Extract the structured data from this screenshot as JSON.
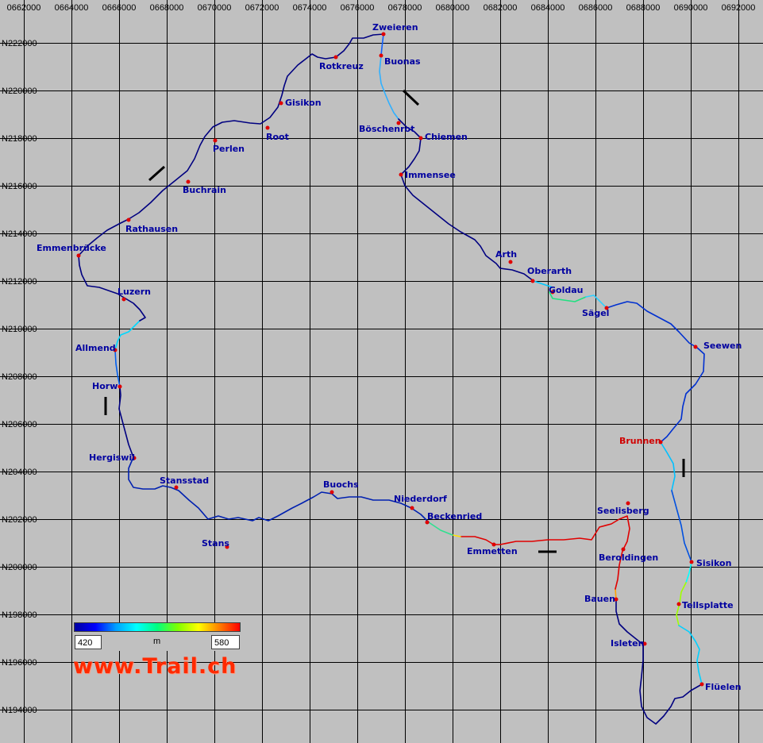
{
  "map": {
    "x_axis_labels": [
      "0662000",
      "0664000",
      "0666000",
      "0668000",
      "0670000",
      "0672000",
      "0674000",
      "0676000",
      "0678000",
      "0680000",
      "0682000",
      "0684000",
      "0686000",
      "0688000",
      "0690000",
      "0692000"
    ],
    "y_axis_labels": [
      "N222000",
      "N220000",
      "N218000",
      "N216000",
      "N214000",
      "N212000",
      "N210000",
      "N208000",
      "N206000",
      "N204000",
      "N202000",
      "N200000",
      "N198000",
      "N196000",
      "N194000"
    ],
    "places": [
      {
        "name": "Zweieren",
        "color": "blue"
      },
      {
        "name": "Rotkreuz",
        "color": "blue"
      },
      {
        "name": "Buonas",
        "color": "blue"
      },
      {
        "name": "Gisikon",
        "color": "blue"
      },
      {
        "name": "Böschenrot",
        "color": "blue"
      },
      {
        "name": "Root",
        "color": "blue"
      },
      {
        "name": "Chiemen",
        "color": "blue"
      },
      {
        "name": "Perlen",
        "color": "blue"
      },
      {
        "name": "Immensee",
        "color": "blue"
      },
      {
        "name": "Buchrain",
        "color": "blue"
      },
      {
        "name": "Rathausen",
        "color": "blue"
      },
      {
        "name": "Emmenbrücke",
        "color": "blue"
      },
      {
        "name": "Arth",
        "color": "blue"
      },
      {
        "name": "Oberarth",
        "color": "blue"
      },
      {
        "name": "Goldau",
        "color": "blue"
      },
      {
        "name": "Luzern",
        "color": "blue"
      },
      {
        "name": "Sägel",
        "color": "blue"
      },
      {
        "name": "Allmend",
        "color": "blue"
      },
      {
        "name": "Seewen",
        "color": "blue"
      },
      {
        "name": "Horw",
        "color": "blue"
      },
      {
        "name": "Brunnen",
        "color": "red"
      },
      {
        "name": "Hergiswil",
        "color": "blue"
      },
      {
        "name": "Stansstad",
        "color": "blue"
      },
      {
        "name": "Buochs",
        "color": "blue"
      },
      {
        "name": "Niederdorf",
        "color": "blue"
      },
      {
        "name": "Seelisberg",
        "color": "blue"
      },
      {
        "name": "Beckenried",
        "color": "blue"
      },
      {
        "name": "Stans",
        "color": "blue"
      },
      {
        "name": "Emmetten",
        "color": "blue"
      },
      {
        "name": "Beroldingen",
        "color": "blue"
      },
      {
        "name": "Sisikon",
        "color": "blue"
      },
      {
        "name": "Bauen",
        "color": "blue"
      },
      {
        "name": "Tellsplatte",
        "color": "blue"
      },
      {
        "name": "Isleten",
        "color": "blue"
      },
      {
        "name": "Flüelen",
        "color": "blue"
      }
    ]
  },
  "legend": {
    "min_value": "420",
    "max_value": "580",
    "unit": "m"
  },
  "brand": {
    "text": "www.Trail.ch",
    "color": "#ff2a00"
  },
  "colors": {
    "background": "#c0c0c0",
    "grid": "#000000",
    "label": "#0000a0",
    "marker": "#e00000"
  }
}
